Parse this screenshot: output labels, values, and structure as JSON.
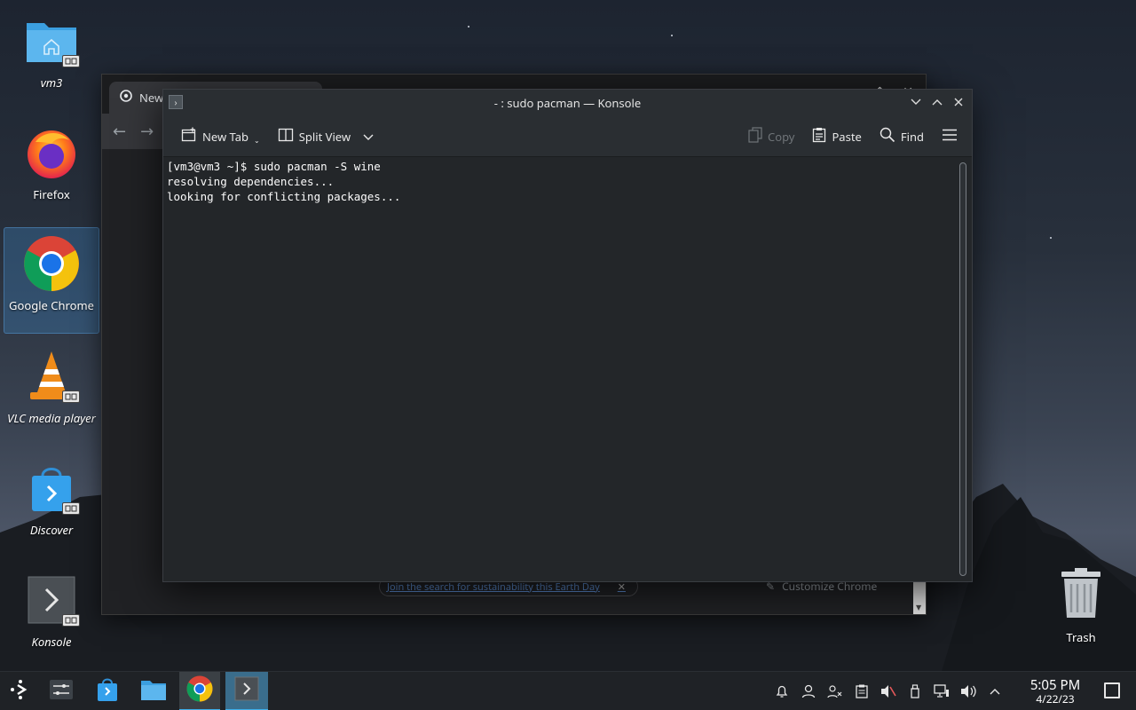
{
  "desktop": {
    "icons": [
      {
        "label": "vm3"
      },
      {
        "label": "Firefox"
      },
      {
        "label": "Google Chrome"
      },
      {
        "label": "VLC media player"
      },
      {
        "label": "Discover"
      },
      {
        "label": "Konsole"
      }
    ],
    "trash_label": "Trash"
  },
  "chrome": {
    "tab_title": "New",
    "bottom_link": "Join the search for sustainability this Earth Day",
    "customize_label": "Customize Chrome"
  },
  "konsole": {
    "title": "- : sudo pacman — Konsole",
    "toolbar": {
      "new_tab": "New Tab",
      "split_view": "Split View",
      "copy": "Copy",
      "paste": "Paste",
      "find": "Find"
    },
    "terminal_lines": [
      "[vm3@vm3 ~]$ sudo pacman -S wine",
      "resolving dependencies...",
      "looking for conflicting packages..."
    ]
  },
  "taskbar": {
    "time": "5:05 PM",
    "date": "4/22/23"
  },
  "colors": {
    "accent": "#3daee9",
    "terminal_bg": "#232629",
    "selection": "#3d82be"
  }
}
